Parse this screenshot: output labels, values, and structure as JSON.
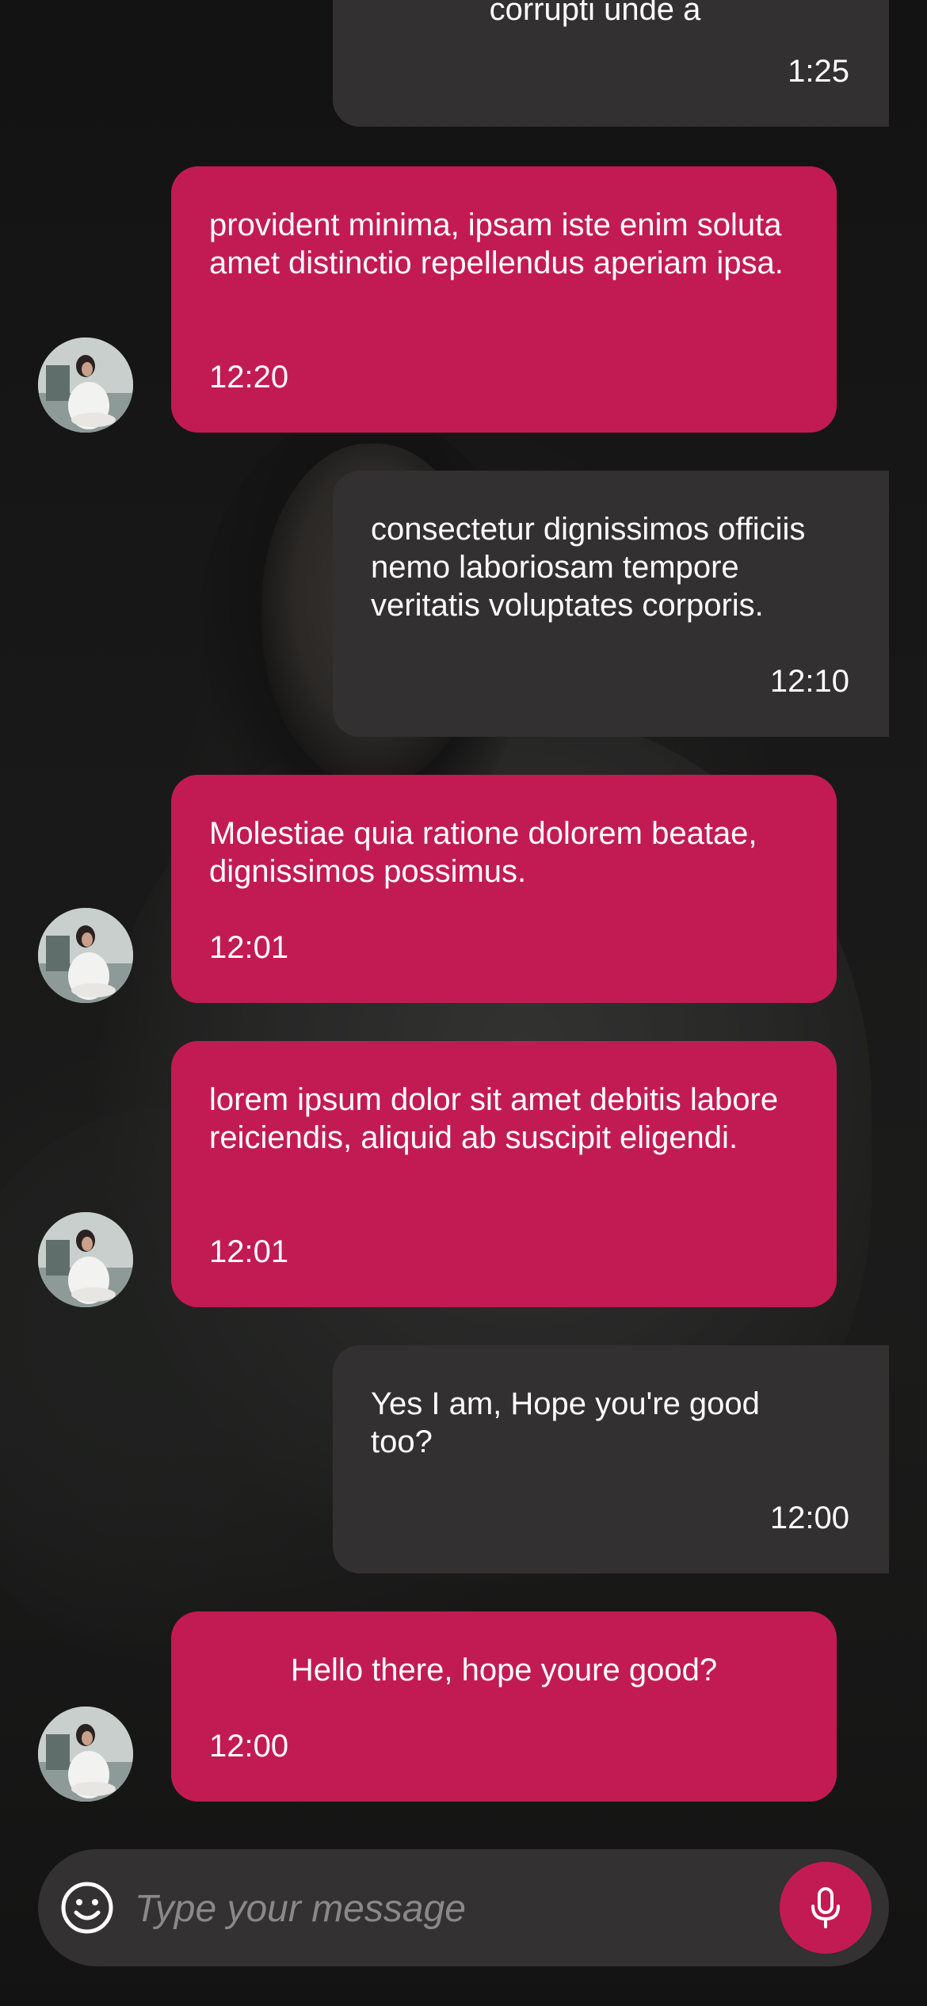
{
  "messages": [
    {
      "from": "me",
      "text": "corrupti unde a",
      "time": "1:25"
    },
    {
      "from": "contact",
      "text": "provident minima, ipsam iste enim soluta amet distinctio repellendus aperiam ipsa.",
      "time": "12:20"
    },
    {
      "from": "me",
      "text": "consectetur dignissimos officiis nemo laboriosam tempore veritatis voluptates corporis.",
      "time": "12:10"
    },
    {
      "from": "contact",
      "text": "Molestiae quia ratione dolorem beatae, dignissimos possimus.",
      "time": "12:01"
    },
    {
      "from": "contact",
      "text": "lorem ipsum dolor sit amet debitis labore reiciendis, aliquid ab suscipit eligendi.",
      "time": "12:01"
    },
    {
      "from": "me",
      "text": "Yes I am, Hope you're good too?",
      "time": "12:00"
    },
    {
      "from": "contact",
      "text": "Hello there, hope youre good?",
      "time": "12:00"
    }
  ],
  "composer": {
    "placeholder": "Type your message",
    "emoji_icon": "smiley-icon",
    "mic_icon": "microphone-icon"
  },
  "colors": {
    "incoming_bubble": "#c21b53",
    "outgoing_bubble": "#323030",
    "composer_bg": "#333131",
    "accent": "#c21b53"
  }
}
